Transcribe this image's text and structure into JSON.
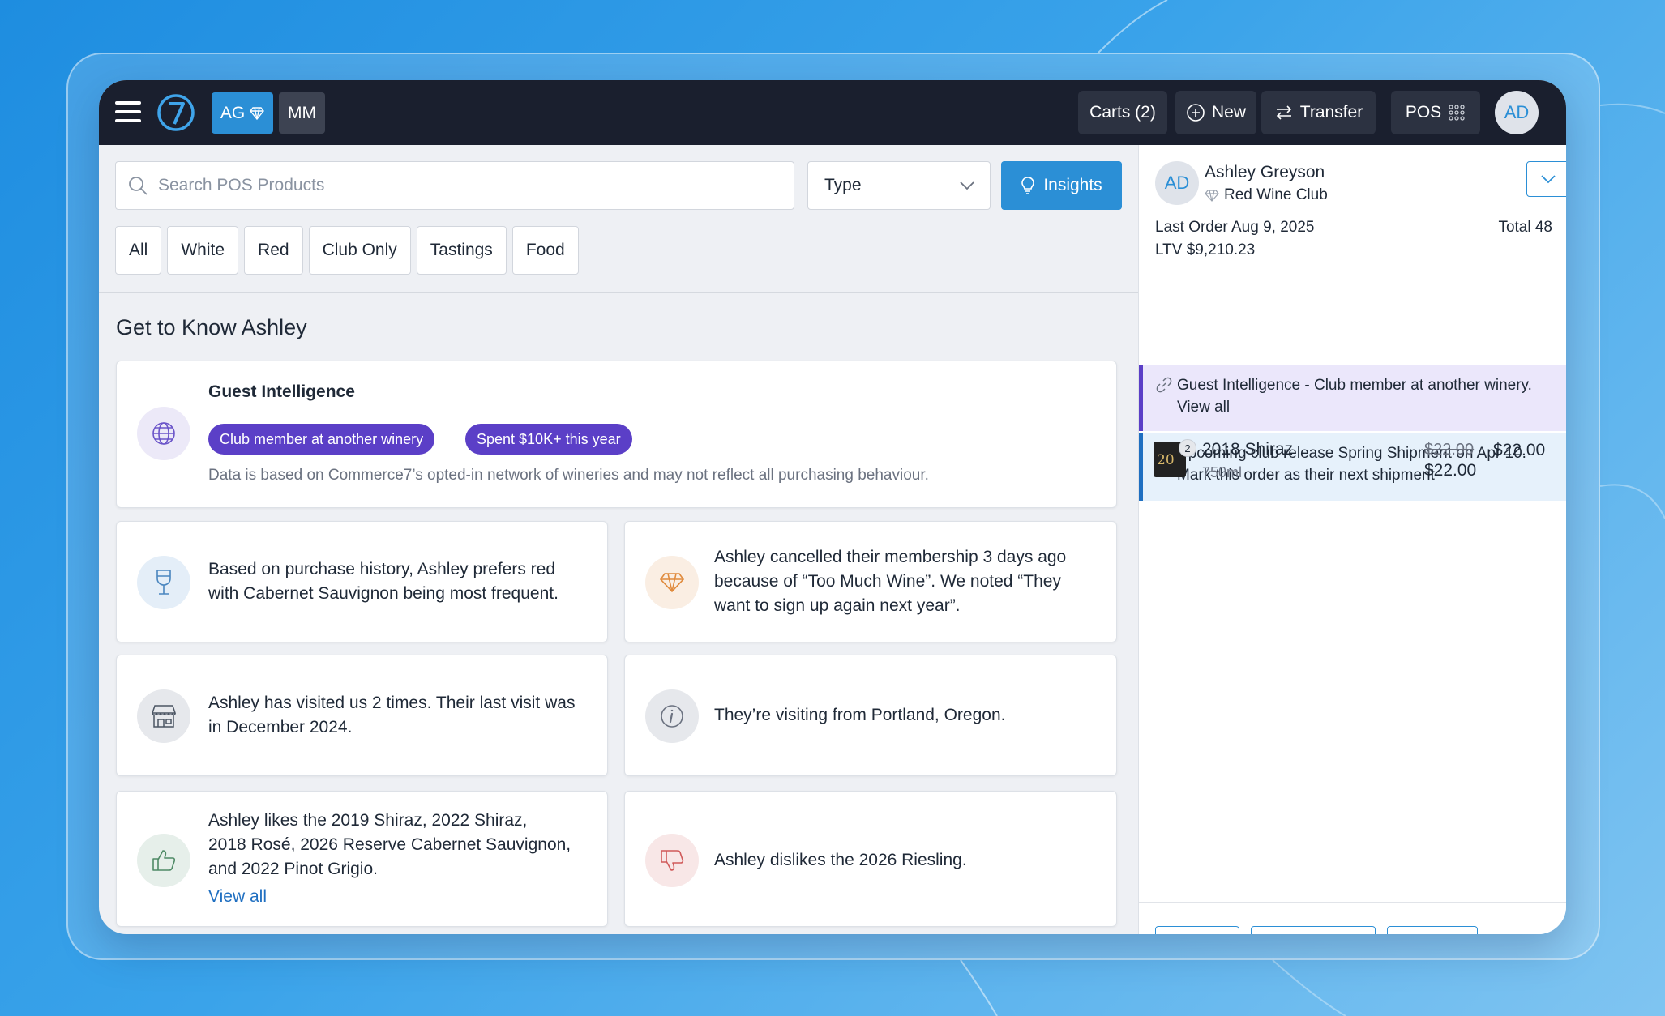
{
  "topbar": {
    "user_initials_primary": "AG",
    "user_initials_secondary": "MM",
    "carts_label": "Carts (2)",
    "new_label": "New",
    "transfer_label": "Transfer",
    "pos_label": "POS",
    "avatar_initials": "AD"
  },
  "search": {
    "placeholder": "Search POS Products"
  },
  "type_select": {
    "value": "Type"
  },
  "insights_label": "Insights",
  "filters": [
    "All",
    "White",
    "Red",
    "Club Only",
    "Tastings",
    "Food"
  ],
  "section_title": "Get to Know Ashley",
  "guest_intelligence": {
    "title": "Guest Intelligence",
    "badges": [
      "Club member at another winery",
      "Spent $10K+ this year"
    ],
    "note": "Data is based on Commerce7’s opted-in network of wineries and may not reflect all purchasing behaviour."
  },
  "insight_cards": {
    "preference": [
      "Based on purchase history, Ashley prefers red",
      "with Cabernet Sauvignon being most frequent."
    ],
    "membership": [
      "Ashley cancelled their membership 3 days ago",
      "because of “Too Much Wine”. We noted “They",
      "want to sign up again next year”."
    ],
    "visits": [
      "Ashley has visited us 2 times. Their last visit was",
      "in December 2024."
    ],
    "location": "They’re visiting from Portland, Oregon.",
    "likes": [
      "Ashley likes the 2019 Shiraz, 2022 Shiraz,",
      "2018 Rosé, 2026 Reserve Cabernet Sauvignon,",
      "and 2022 Pinot Grigio."
    ],
    "likes_link": "View all",
    "dislikes": "Ashley dislikes the 2026 Riesling."
  },
  "customer": {
    "initials": "AD",
    "name": "Ashley Greyson",
    "club": "Red Wine Club",
    "last_order": "Last Order Aug 9, 2025",
    "total": "Total 48",
    "ltv": "LTV $9,210.23"
  },
  "notices": [
    "Guest Intelligence - Club member at another winery. View all",
    "Upcoming club release Spring Shipment on Apr 10. Mark this order as their next shipment"
  ],
  "cart_item": {
    "qty": "2",
    "name": "2018 Shiraz",
    "size": "750ml",
    "price_original": "$22.00",
    "price_unit": "$22.00",
    "price_total": "$22.00",
    "label_text": "20"
  },
  "colors": {
    "topbar": "#1a1f2e",
    "accent": "#2b8fd6",
    "badge_purple": "#5b3fc7"
  }
}
